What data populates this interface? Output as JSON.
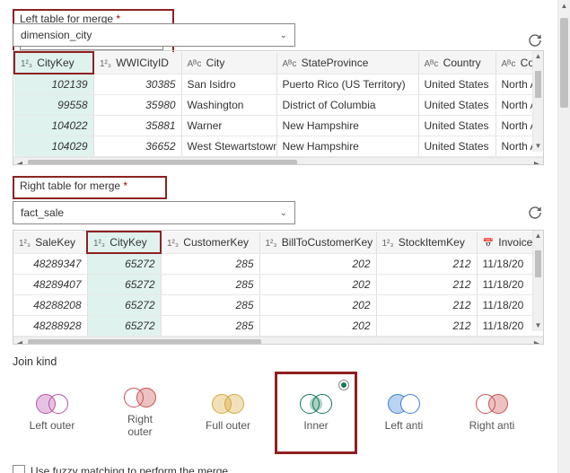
{
  "left": {
    "label": "Left table for merge",
    "req": "*",
    "value": "dimension_city",
    "columns": [
      {
        "type": "1²₃",
        "name": "CityKey",
        "selected": true
      },
      {
        "type": "1²₃",
        "name": "WWICityID"
      },
      {
        "type": "Aᴮc",
        "name": "City"
      },
      {
        "type": "Aᴮc",
        "name": "StateProvince"
      },
      {
        "type": "Aᴮc",
        "name": "Country"
      },
      {
        "type": "Aᴮc",
        "name": "Continent"
      }
    ],
    "rows": [
      [
        "102139",
        "30385",
        "San Isidro",
        "Puerto Rico (US Territory)",
        "United States",
        "North Amer"
      ],
      [
        "99558",
        "35980",
        "Washington",
        "District of Columbia",
        "United States",
        "North Amer"
      ],
      [
        "104022",
        "35881",
        "Warner",
        "New Hampshire",
        "United States",
        "North Amer"
      ],
      [
        "104029",
        "36652",
        "West Stewartstown",
        "New Hampshire",
        "United States",
        "North Amer"
      ]
    ]
  },
  "right": {
    "label": "Right table for merge",
    "req": "*",
    "value": "fact_sale",
    "columns": [
      {
        "type": "1²₃",
        "name": "SaleKey"
      },
      {
        "type": "1²₃",
        "name": "CityKey",
        "selected": true
      },
      {
        "type": "1²₃",
        "name": "CustomerKey"
      },
      {
        "type": "1²₃",
        "name": "BillToCustomerKey"
      },
      {
        "type": "1²₃",
        "name": "StockItemKey"
      },
      {
        "type": "📅",
        "name": "InvoiceDa"
      }
    ],
    "rows": [
      [
        "48289347",
        "65272",
        "285",
        "202",
        "212",
        "11/18/20"
      ],
      [
        "48289407",
        "65272",
        "285",
        "202",
        "212",
        "11/18/20"
      ],
      [
        "48288208",
        "65272",
        "285",
        "202",
        "212",
        "11/18/20"
      ],
      [
        "48288928",
        "65272",
        "285",
        "202",
        "212",
        "11/18/20"
      ]
    ]
  },
  "join": {
    "label": "Join kind",
    "kinds": [
      {
        "id": "left-outer",
        "name": "Left outer",
        "color": "#b84fa8"
      },
      {
        "id": "right-outer",
        "name": "Right outer",
        "color": "#c94f4f",
        "name2": "Right\nouter"
      },
      {
        "id": "full-outer",
        "name": "Full outer",
        "color": "#d7a83a"
      },
      {
        "id": "inner",
        "name": "Inner",
        "color": "#0f7a5a",
        "selected": true
      },
      {
        "id": "left-anti",
        "name": "Left anti",
        "color": "#3a7fd7"
      },
      {
        "id": "right-anti",
        "name": "Right anti",
        "color": "#c94f4f"
      }
    ]
  },
  "fuzzy": {
    "label": "Use fuzzy matching to perform the merge",
    "checked": false
  }
}
